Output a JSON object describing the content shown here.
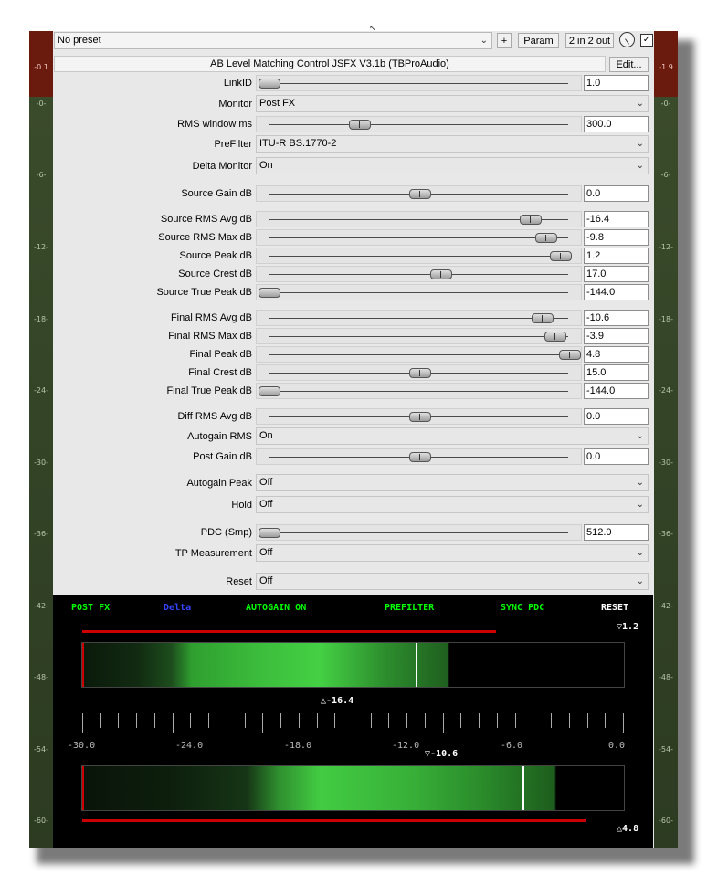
{
  "toolbar": {
    "preset": "No preset",
    "plus_label": "+",
    "param_label": "Param",
    "io_label": "2 in 2 out",
    "edit_label": "Edit...",
    "title": "AB Level Matching Control JSFX V3.1b (TBProAudio)"
  },
  "meters": {
    "left_top": "-0.1",
    "right_top": "-1.9",
    "ticks": [
      "-0-",
      "-6-",
      "-12-",
      "-18-",
      "-24-",
      "-30-",
      "-36-",
      "-42-",
      "-48-",
      "-54-",
      "-60-"
    ]
  },
  "params": {
    "linkid": {
      "label": "LinkID",
      "value": "1.0",
      "position": 0.0
    },
    "monitor": {
      "label": "Monitor",
      "value": "Post FX"
    },
    "rms_window": {
      "label": "RMS window ms",
      "value": "300.0",
      "position": 0.3
    },
    "prefilter": {
      "label": "PreFilter",
      "value": "ITU-R BS.1770-2"
    },
    "delta_monitor": {
      "label": "Delta Monitor",
      "value": "On"
    },
    "source_gain": {
      "label": "Source Gain dB",
      "value": "0.0",
      "position": 0.5
    },
    "source_rms_avg": {
      "label": "Source RMS Avg dB",
      "value": "-16.4",
      "position": 0.87
    },
    "source_rms_max": {
      "label": "Source RMS Max dB",
      "value": "-9.8",
      "position": 0.92
    },
    "source_peak": {
      "label": "Source Peak dB",
      "value": "1.2",
      "position": 0.97
    },
    "source_crest": {
      "label": "Source Crest dB",
      "value": "17.0",
      "position": 0.57
    },
    "source_true_peak": {
      "label": "Source True Peak dB",
      "value": "-144.0",
      "position": 0.0
    },
    "final_rms_avg": {
      "label": "Final RMS Avg dB",
      "value": "-10.6",
      "position": 0.91
    },
    "final_rms_max": {
      "label": "Final RMS Max dB",
      "value": "-3.9",
      "position": 0.95
    },
    "final_peak": {
      "label": "Final Peak dB",
      "value": "4.8",
      "position": 1.0
    },
    "final_crest": {
      "label": "Final Crest dB",
      "value": "15.0",
      "position": 0.5
    },
    "final_true_peak": {
      "label": "Final True Peak dB",
      "value": "-144.0",
      "position": 0.0
    },
    "diff_rms_avg": {
      "label": "Diff RMS Avg dB",
      "value": "0.0",
      "position": 0.5
    },
    "autogain_rms": {
      "label": "Autogain RMS",
      "value": "On"
    },
    "post_gain": {
      "label": "Post Gain dB",
      "value": "0.0",
      "position": 0.5
    },
    "autogain_peak": {
      "label": "Autogain Peak",
      "value": "Off"
    },
    "hold": {
      "label": "Hold",
      "value": "Off"
    },
    "pdc": {
      "label": "PDC (Smp)",
      "value": "512.0",
      "position": 0.0
    },
    "tp_measurement": {
      "label": "TP Measurement",
      "value": "Off"
    },
    "reset": {
      "label": "Reset",
      "value": "Off"
    }
  },
  "display": {
    "post_fx": "POST FX",
    "delta": "Delta",
    "autogain": "AUTOGAIN ON",
    "prefilter": "PREFILTER",
    "sync_pdc": "SYNC PDC",
    "reset": "RESET",
    "source_peak": "1.2",
    "source_rms": "-16.4",
    "final_rms": "-10.6",
    "final_peak": "4.8",
    "scale": [
      "-30.0",
      "-24.0",
      "-18.0",
      "-12.0",
      "-6.0",
      "0.0"
    ],
    "colors": {
      "green": "#00ff00",
      "blue": "#3344ff",
      "red": "#cc0000",
      "white": "#ffffff"
    }
  }
}
